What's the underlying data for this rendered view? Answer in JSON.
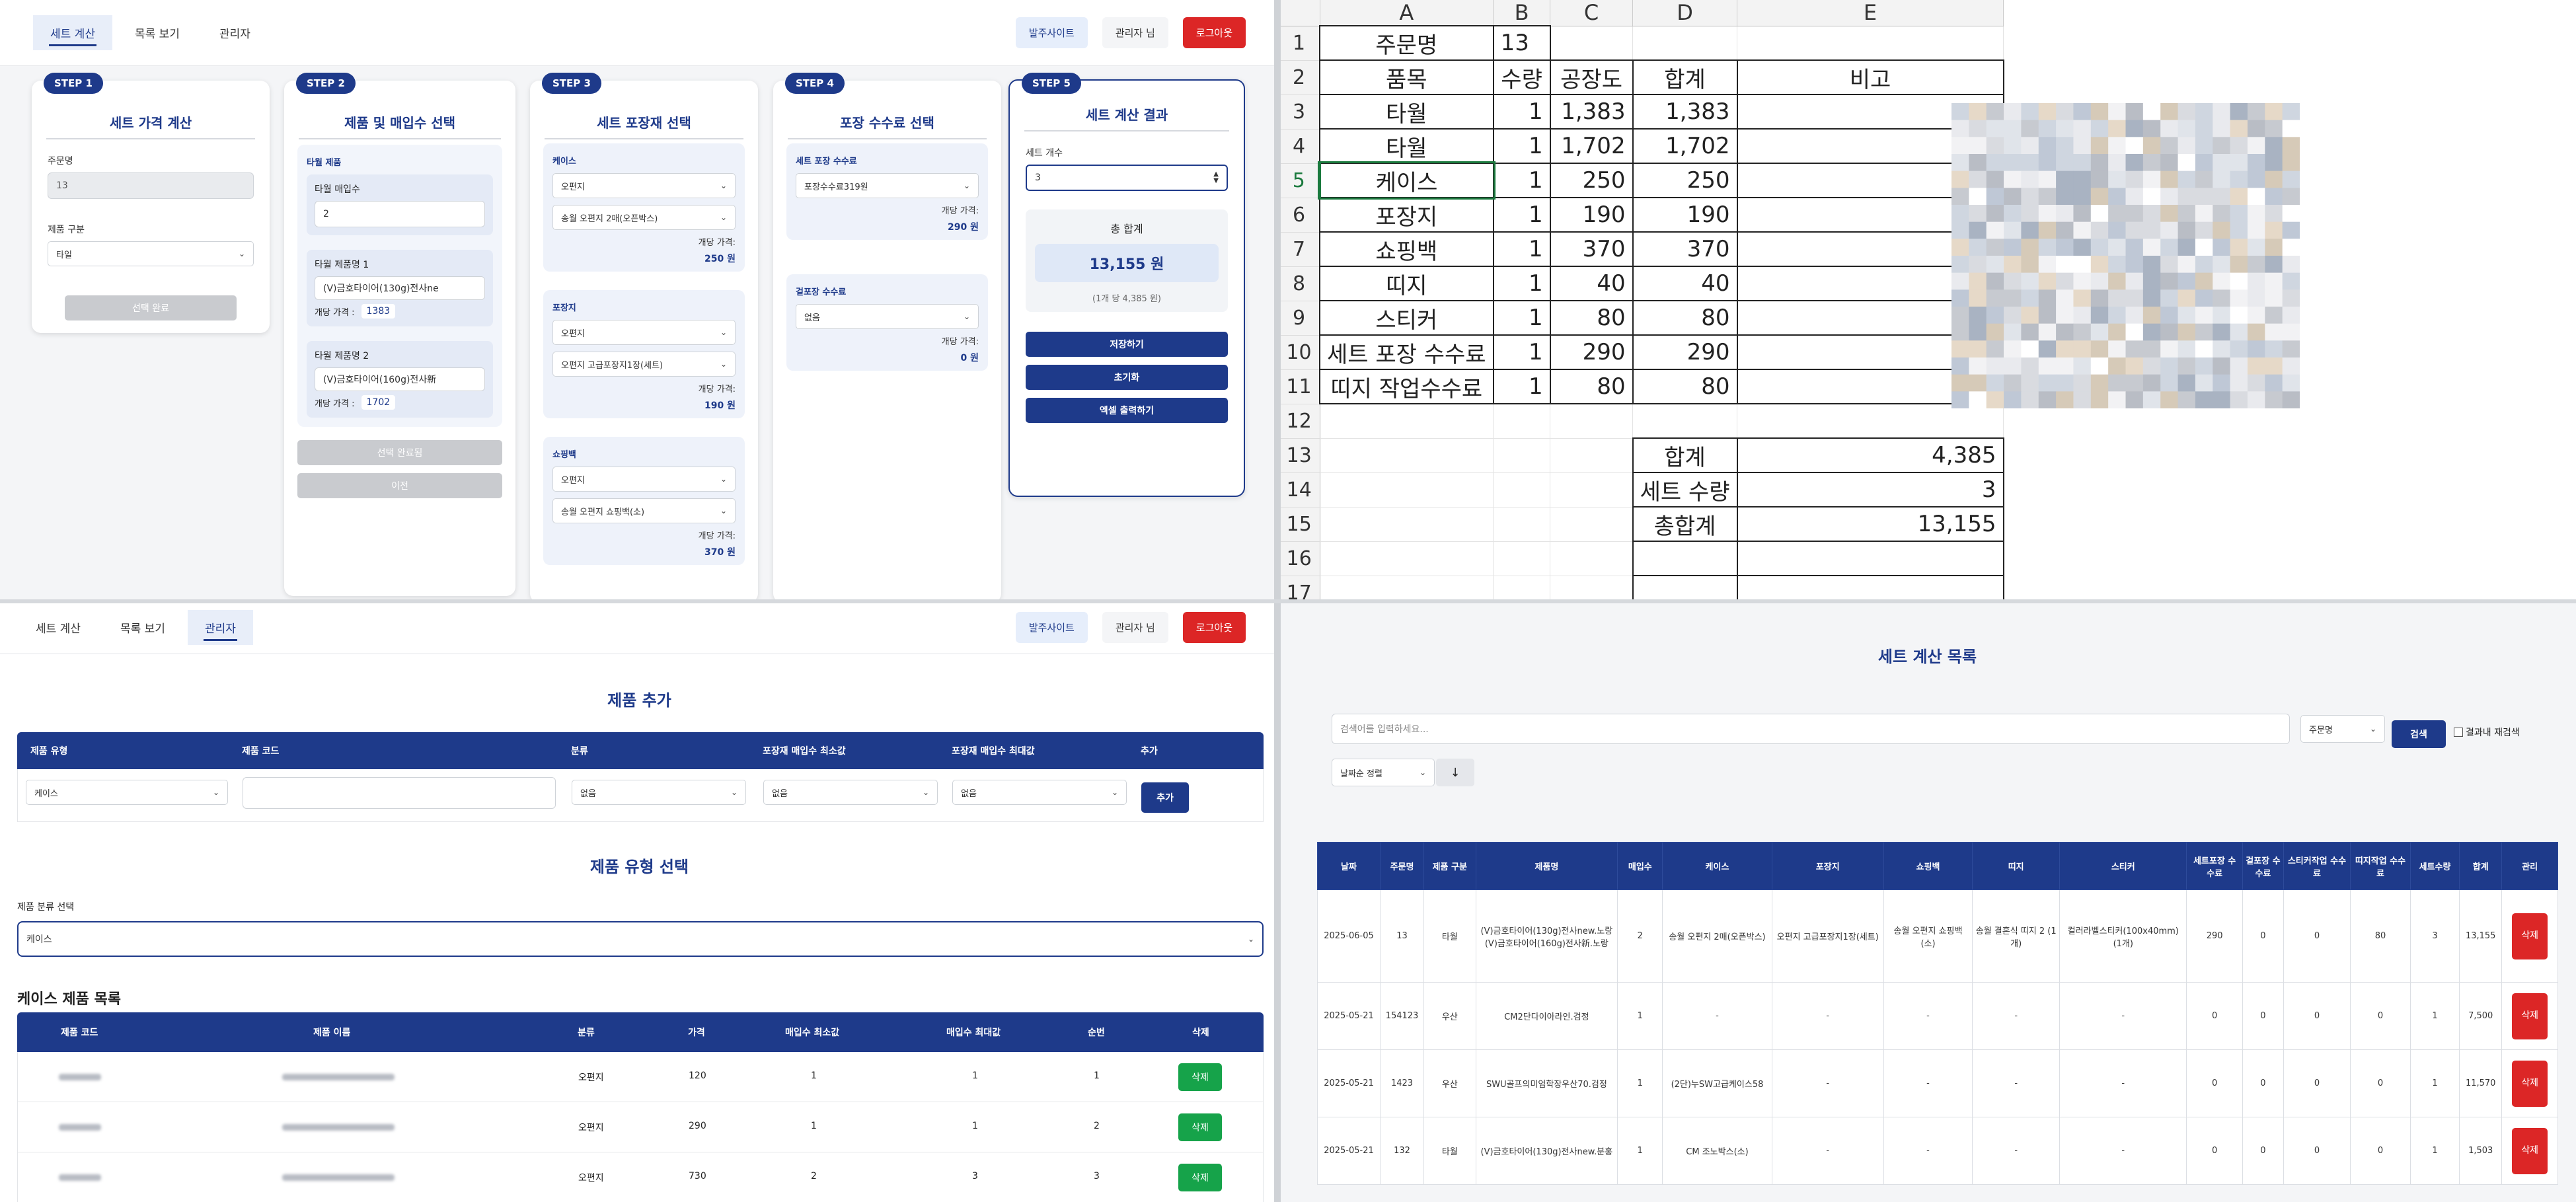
{
  "nav": {
    "tabs": [
      "세트 계산",
      "목록 보기",
      "관리자"
    ],
    "site_btn": "발주사이트",
    "admin_btn": "관리자 님",
    "logout_btn": "로그아웃"
  },
  "step1": {
    "badge": "STEP 1",
    "title": "세트 가격 계산",
    "order_label": "주문명",
    "order_value": "13",
    "category_label": "제품 구분",
    "category_value": "타일",
    "done_btn": "선택 완료"
  },
  "step2": {
    "badge": "STEP 2",
    "title": "제품 및 매입수 선택",
    "section": "타월 제품",
    "qty_label": "타월 매입수",
    "qty_value": "2",
    "p1_label": "타월 제품명 1",
    "p1_value": "(V)금호타이어(130g)전사ne",
    "p1_price_label": "개당 가격 :",
    "p1_price": "1383",
    "p2_label": "타월 제품명 2",
    "p2_value": "(V)금호타이어(160g)전사新",
    "p2_price_label": "개당 가격 :",
    "p2_price": "1702",
    "done_btn": "선택 완료됨",
    "prev_btn": "이전"
  },
  "step3": {
    "badge": "STEP 3",
    "title": "세트 포장재 선택",
    "case_label": "케이스",
    "case_sel1": "오편지",
    "case_sel2": "송월 오편지 2매(오픈박스)",
    "case_price_label": "개당 가격:",
    "case_price": "250 원",
    "wrap_label": "포장지",
    "wrap_sel1": "오편지",
    "wrap_sel2": "오편지 고급포장지1장(세트)",
    "wrap_price_label": "개당 가격:",
    "wrap_price": "190 원",
    "bag_label": "쇼핑백",
    "bag_sel1": "오편지",
    "bag_sel2": "송월 오편지 쇼핑백(소)",
    "bag_price_label": "개당 가격:",
    "bag_price": "370 원"
  },
  "step4": {
    "badge": "STEP 4",
    "title": "포장 수수료 선택",
    "fee_label": "세트 포장 수수료",
    "fee_sel": "포장수수료319원",
    "fee_price_label": "개당 가격:",
    "fee_price": "290 원",
    "outer_label": "겉포장 수수료",
    "outer_sel": "없음",
    "outer_price_label": "개당 가격:",
    "outer_price": "0 원"
  },
  "step5": {
    "badge": "STEP 5",
    "title": "세트 계산 결과",
    "count_label": "세트 개수",
    "count_value": "3",
    "total_label": "총 합계",
    "total_value": "13,155 원",
    "per_unit": "(1개 당 4,385 원)",
    "save_btn": "저장하기",
    "reset_btn": "초기화",
    "excel_btn": "엑셀 출력하기"
  },
  "sheet": {
    "cols": [
      "A",
      "B",
      "C",
      "D",
      "E"
    ],
    "rows": [
      {
        "n": "1",
        "a": "주문명",
        "b": "13",
        "c": "",
        "d": "",
        "e": ""
      },
      {
        "n": "2",
        "a": "품목",
        "b": "수량",
        "c": "공장도",
        "d": "합계",
        "e": "비고"
      },
      {
        "n": "3",
        "a": "타월",
        "b": "1",
        "c": "1,383",
        "d": "1,383",
        "e": ""
      },
      {
        "n": "4",
        "a": "타월",
        "b": "1",
        "c": "1,702",
        "d": "1,702",
        "e": ""
      },
      {
        "n": "5",
        "a": "케이스",
        "b": "1",
        "c": "250",
        "d": "250",
        "e": ""
      },
      {
        "n": "6",
        "a": "포장지",
        "b": "1",
        "c": "190",
        "d": "190",
        "e": ""
      },
      {
        "n": "7",
        "a": "쇼핑백",
        "b": "1",
        "c": "370",
        "d": "370",
        "e": ""
      },
      {
        "n": "8",
        "a": "띠지",
        "b": "1",
        "c": "40",
        "d": "40",
        "e": ""
      },
      {
        "n": "9",
        "a": "스티커",
        "b": "1",
        "c": "80",
        "d": "80",
        "e": ""
      },
      {
        "n": "10",
        "a": "세트 포장 수수료",
        "b": "1",
        "c": "290",
        "d": "290",
        "e": ""
      },
      {
        "n": "11",
        "a": "띠지 작업수수료",
        "b": "1",
        "c": "80",
        "d": "80",
        "e": ""
      },
      {
        "n": "12",
        "a": "",
        "b": "",
        "c": "",
        "d": "",
        "e": ""
      },
      {
        "n": "13",
        "a": "",
        "b": "",
        "c": "",
        "d": "합계",
        "e": "4,385"
      },
      {
        "n": "14",
        "a": "",
        "b": "",
        "c": "",
        "d": "세트 수량",
        "e": "3"
      },
      {
        "n": "15",
        "a": "",
        "b": "",
        "c": "",
        "d": "총합계",
        "e": "13,155"
      },
      {
        "n": "16",
        "a": "",
        "b": "",
        "c": "",
        "d": "",
        "e": ""
      },
      {
        "n": "17",
        "a": "",
        "b": "",
        "c": "",
        "d": "",
        "e": ""
      }
    ]
  },
  "admin": {
    "add_title": "제품 추가",
    "add_headers": [
      "제품 유형",
      "제품 코드",
      "분류",
      "포장재 매입수 최소값",
      "포장재 매입수 최대값",
      "추가"
    ],
    "add_type_value": "케이스",
    "add_class_value": "없음",
    "add_min_value": "없음",
    "add_max_value": "없음",
    "add_btn": "추가",
    "type_title": "제품 유형 선택",
    "type_label": "제품 분류 선택",
    "type_value": "케이스",
    "list_title": "케이스 제품 목록",
    "list_headers": [
      "제품 코드",
      "제품 이름",
      "분류",
      "가격",
      "매입수 최소값",
      "매입수 최대값",
      "순번",
      "삭제"
    ],
    "rows": [
      {
        "cls": "오편지",
        "price": "120",
        "min": "1",
        "max": "1",
        "ord": "1"
      },
      {
        "cls": "오편지",
        "price": "290",
        "min": "1",
        "max": "1",
        "ord": "2"
      },
      {
        "cls": "오편지",
        "price": "730",
        "min": "2",
        "max": "3",
        "ord": "3"
      }
    ],
    "del_btn": "삭제"
  },
  "list": {
    "title": "세트 계산 목록",
    "search_placeholder": "검색어를 입력하세요...",
    "search_field": "주문명",
    "search_btn": "검색",
    "research_label": "결과내 재검색",
    "sort_value": "날짜순 정렬",
    "sort_dir": "↓",
    "headers": [
      "날짜",
      "주문명",
      "제품 구분",
      "제품명",
      "매입수",
      "케이스",
      "포장지",
      "쇼핑백",
      "띠지",
      "스티커",
      "세트포장 수수료",
      "겉포장 수수료",
      "스티커작업 수수료",
      "띠지작업 수수료",
      "세트수량",
      "합계",
      "관리"
    ],
    "rows": [
      {
        "date": "2025-06-05",
        "order": "13",
        "cat": "타월",
        "name": "(V)금호타이어(130g)전사new.노랑 (V)금호타이어(160g)전사新.노랑",
        "qty": "2",
        "case": "송월 오편지 2매(오픈박스)",
        "wrap": "오편지 고급포장지1장(세트)",
        "bag": "송월 오편지 쇼핑백(소)",
        "band": "송월 결혼식 띠지 2 (1개)",
        "sticker": "컬러라벨스티커(100x40mm) (1개)",
        "f1": "290",
        "f2": "0",
        "f3": "0",
        "f4": "80",
        "sets": "3",
        "sum": "13,155"
      },
      {
        "date": "2025-05-21",
        "order": "154123",
        "cat": "우산",
        "name": "CM2단다이아라인.검정",
        "qty": "1",
        "case": "-",
        "wrap": "-",
        "bag": "-",
        "band": "-",
        "sticker": "-",
        "f1": "0",
        "f2": "0",
        "f3": "0",
        "f4": "0",
        "sets": "1",
        "sum": "7,500"
      },
      {
        "date": "2025-05-21",
        "order": "1423",
        "cat": "우산",
        "name": "SWU골프의미엄학장우산70.검정",
        "qty": "1",
        "case": "(2단)누SW고급케이스58",
        "wrap": "-",
        "bag": "-",
        "band": "-",
        "sticker": "-",
        "f1": "0",
        "f2": "0",
        "f3": "0",
        "f4": "0",
        "sets": "1",
        "sum": "11,570"
      },
      {
        "date": "2025-05-21",
        "order": "132",
        "cat": "타월",
        "name": "(V)금호타이어(130g)전사new.분홍",
        "qty": "1",
        "case": "CM 조노박스(소)",
        "wrap": "-",
        "bag": "-",
        "band": "-",
        "sticker": "-",
        "f1": "0",
        "f2": "0",
        "f3": "0",
        "f4": "0",
        "sets": "1",
        "sum": "1,503"
      }
    ],
    "del_btn": "삭제"
  }
}
